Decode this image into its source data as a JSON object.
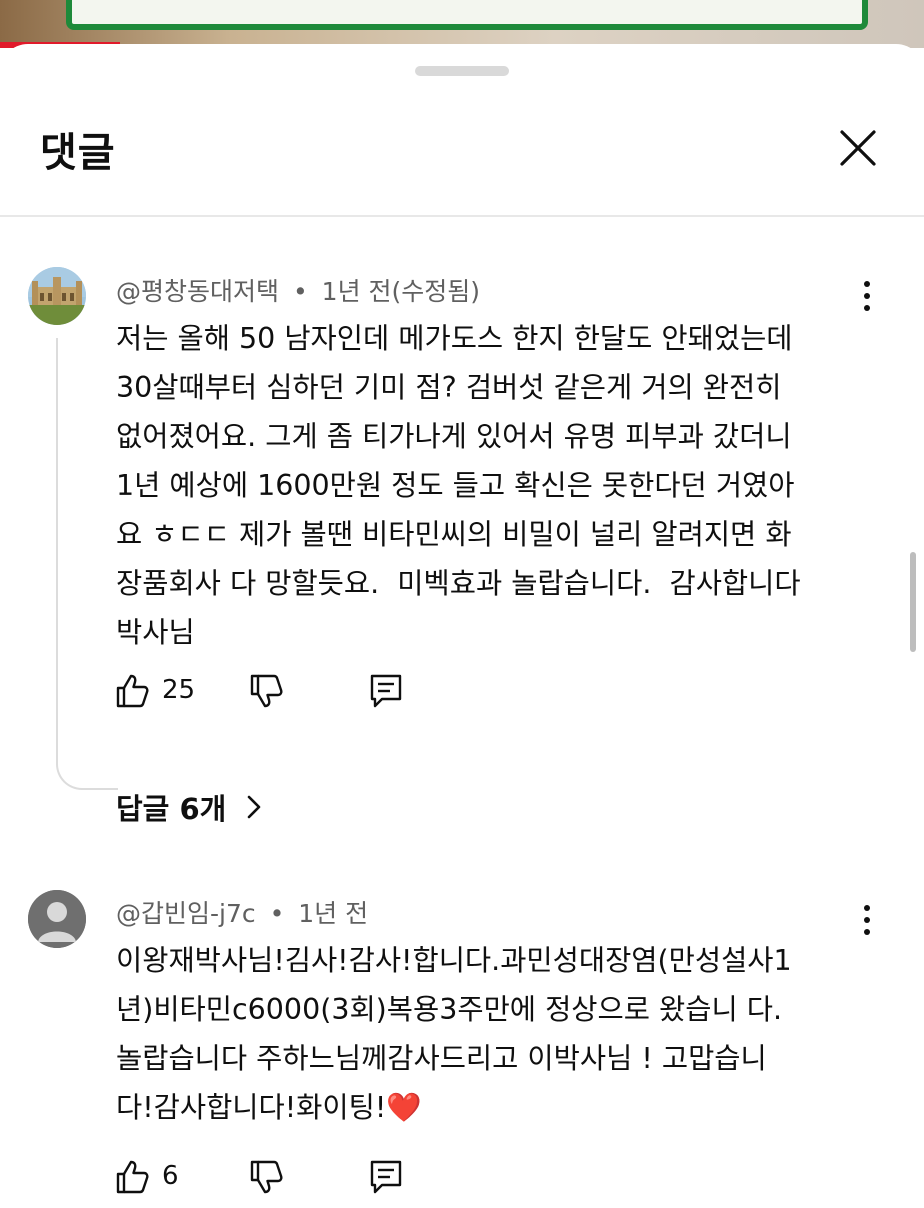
{
  "panel": {
    "title": "댓글"
  },
  "comments": [
    {
      "author": "@평창동대저택",
      "time": "1년 전(수정됨)",
      "text": "저는 올해 50 남자인데 메가도스 한지 한달도 안돼었는데\n30살때부터 심하던 기미 점? 검버섯 같은게 거의 완전히\n없어졌어요. 그게 좀 티가나게 있어서 유명 피부과 갔더니\n1년 예상에 1600만원 정도 들고 확신은 못한다던 거였아\n요 ㅎㄷㄷ 제가 볼땐 비타민씨의 비밀이 널리 알려지면 화\n장품회사 다 망할듯요.  미벡효과 놀랍습니다.  감사합니다\n박사님",
      "likes": "25",
      "replies_label": "답글 6개"
    },
    {
      "author": "@갑빈임-j7c",
      "time": "1년 전",
      "text": "이왕재박사님!김사!감사!합니다.과민성대장염(만성설사1\n년)비타민c6000(3회)복용3주만에 정상으로 왔습니 다.\n놀랍습니다 주하느님께감사드리고 이박사님 ! 고맙습니\n다!감사합니다!화이팅!",
      "emoji": "❤️",
      "likes": "6"
    }
  ],
  "separator": "•",
  "colors": {
    "text_primary": "#0f0f0f",
    "text_secondary": "#606060",
    "divider": "#e8e8e8",
    "caption_green": "#1e8a3a",
    "accent_red": "#e11a2b"
  },
  "icons": [
    "close-icon",
    "more-vert-icon",
    "thumb-up-icon",
    "thumb-down-icon",
    "reply-comment-icon",
    "chevron-right-icon"
  ]
}
